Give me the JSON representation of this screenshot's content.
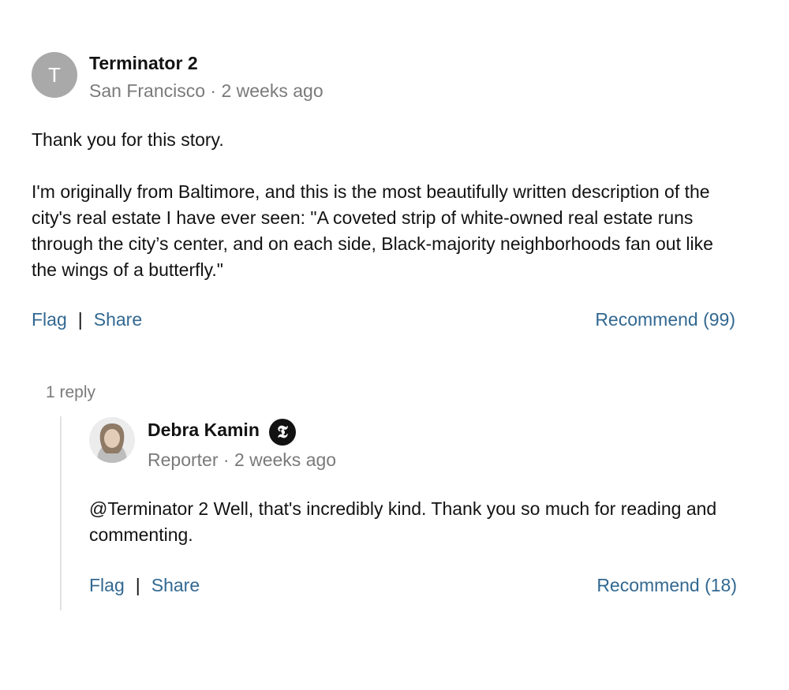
{
  "comment": {
    "avatar_letter": "T",
    "author": "Terminator 2",
    "location": "San Francisco",
    "separator": " · ",
    "time": "2 weeks ago",
    "paragraphs": [
      "Thank you for this story.",
      "I'm originally from Baltimore, and this is the most beautifully written description of the city's real estate I have ever seen: \"A coveted strip of white-owned real estate runs through the city’s center, and on each side, Black-majority neighborhoods fan out like the wings of a butterfly.\""
    ],
    "actions": {
      "flag": "Flag",
      "divider": "|",
      "share": "Share",
      "recommend": "Recommend (99)"
    }
  },
  "replies": {
    "count_label": "1 reply",
    "items": [
      {
        "author": "Debra Kamin",
        "badge_icon": "nyt-logo-icon",
        "badge_glyph": "𝕿",
        "role": "Reporter",
        "separator": " · ",
        "time": "2 weeks ago",
        "text": "@Terminator 2 Well, that's incredibly kind. Thank you so much for reading and commenting.",
        "actions": {
          "flag": "Flag",
          "divider": "|",
          "share": "Share",
          "recommend": "Recommend (18)"
        }
      }
    ]
  },
  "colors": {
    "link": "#326891",
    "meta": "#7a7a7a",
    "avatar": "#a9a9a9",
    "thread_line": "#e2e2e2"
  }
}
